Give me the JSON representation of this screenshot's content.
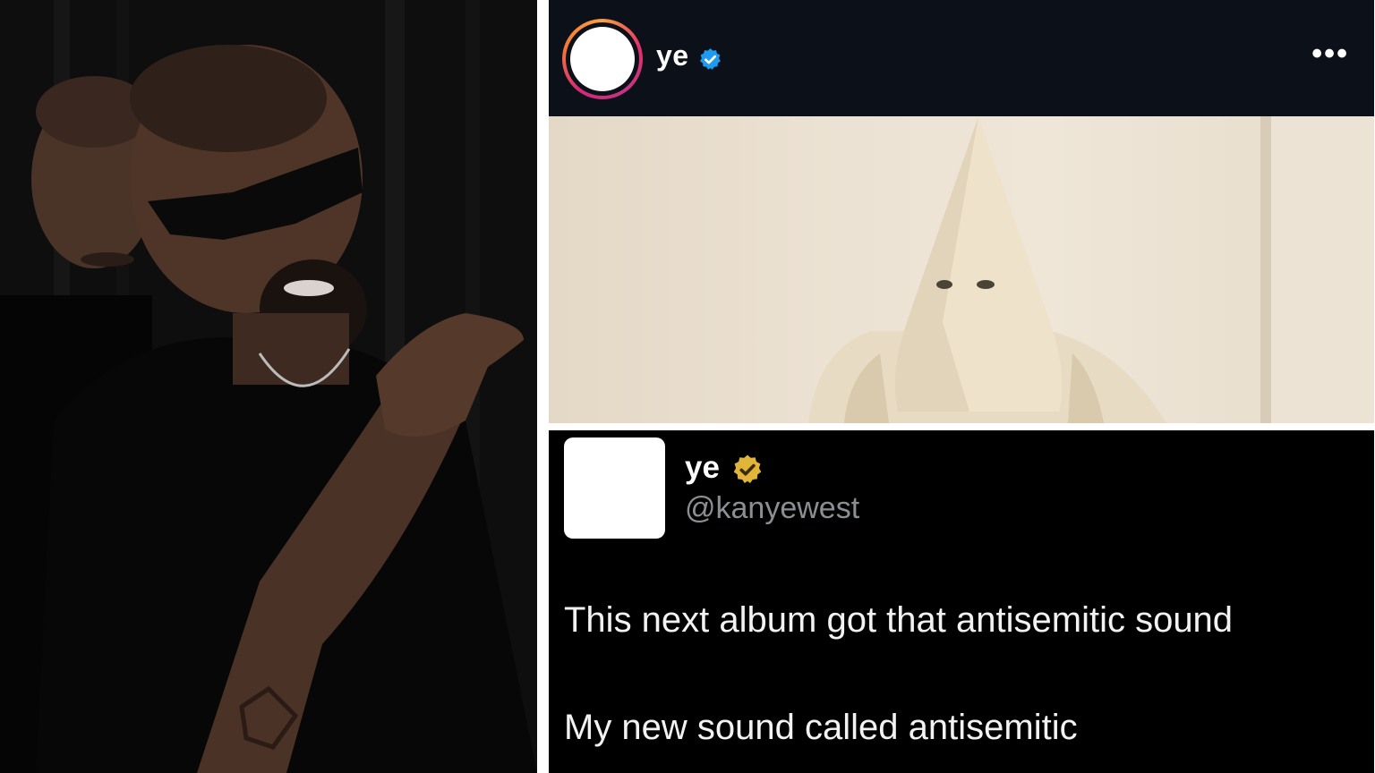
{
  "ig_post": {
    "username": "ye",
    "more_label": "•••",
    "icons": {
      "verified": "verified-badge-icon",
      "more": "more-options-icon"
    },
    "colors": {
      "background": "#0c1119",
      "verified": "#1d9bf0"
    }
  },
  "tweet": {
    "name": "ye",
    "handle": "@kanyewest",
    "lines": [
      "This next album got that antisemitic sound",
      "My new sound called antisemitic"
    ],
    "icons": {
      "badge": "gold-verified-badge-icon"
    },
    "colors": {
      "background": "#000000",
      "badge": "#e0b53a",
      "handle": "#8b8f94"
    }
  }
}
